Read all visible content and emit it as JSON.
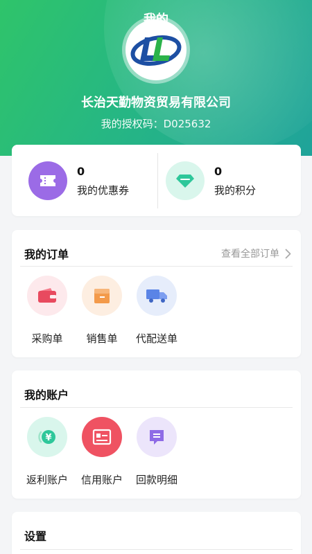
{
  "header": {
    "title": "我的",
    "logo_text": "LL",
    "company_name": "长治天勤物资贸易有限公司",
    "auth_code_text": "我的授权码：D025632"
  },
  "stats": [
    {
      "value": "0",
      "label": "我的优惠券",
      "icon": "coupon-icon",
      "color": "#9b6be6"
    },
    {
      "value": "0",
      "label": "我的积分",
      "icon": "diamond-icon",
      "color": "#2ec79a"
    }
  ],
  "orders": {
    "title": "我的订单",
    "view_all": "查看全部订单",
    "items": [
      {
        "label": "采购单",
        "icon": "wallet-icon",
        "color": "#e84a5f"
      },
      {
        "label": "销售单",
        "icon": "box-icon",
        "color": "#f39a4a"
      },
      {
        "label": "代配送单",
        "icon": "truck-icon",
        "color": "#5a84e6"
      }
    ]
  },
  "account": {
    "title": "我的账户",
    "items": [
      {
        "label": "返利账户",
        "icon": "rebate-yen-icon",
        "color": "#2ec79a"
      },
      {
        "label": "信用账户",
        "icon": "credit-card-icon",
        "color": "#ef5262"
      },
      {
        "label": "回款明细",
        "icon": "payment-detail-icon",
        "color": "#8e6be6"
      }
    ]
  },
  "settings": {
    "title": "设置"
  }
}
